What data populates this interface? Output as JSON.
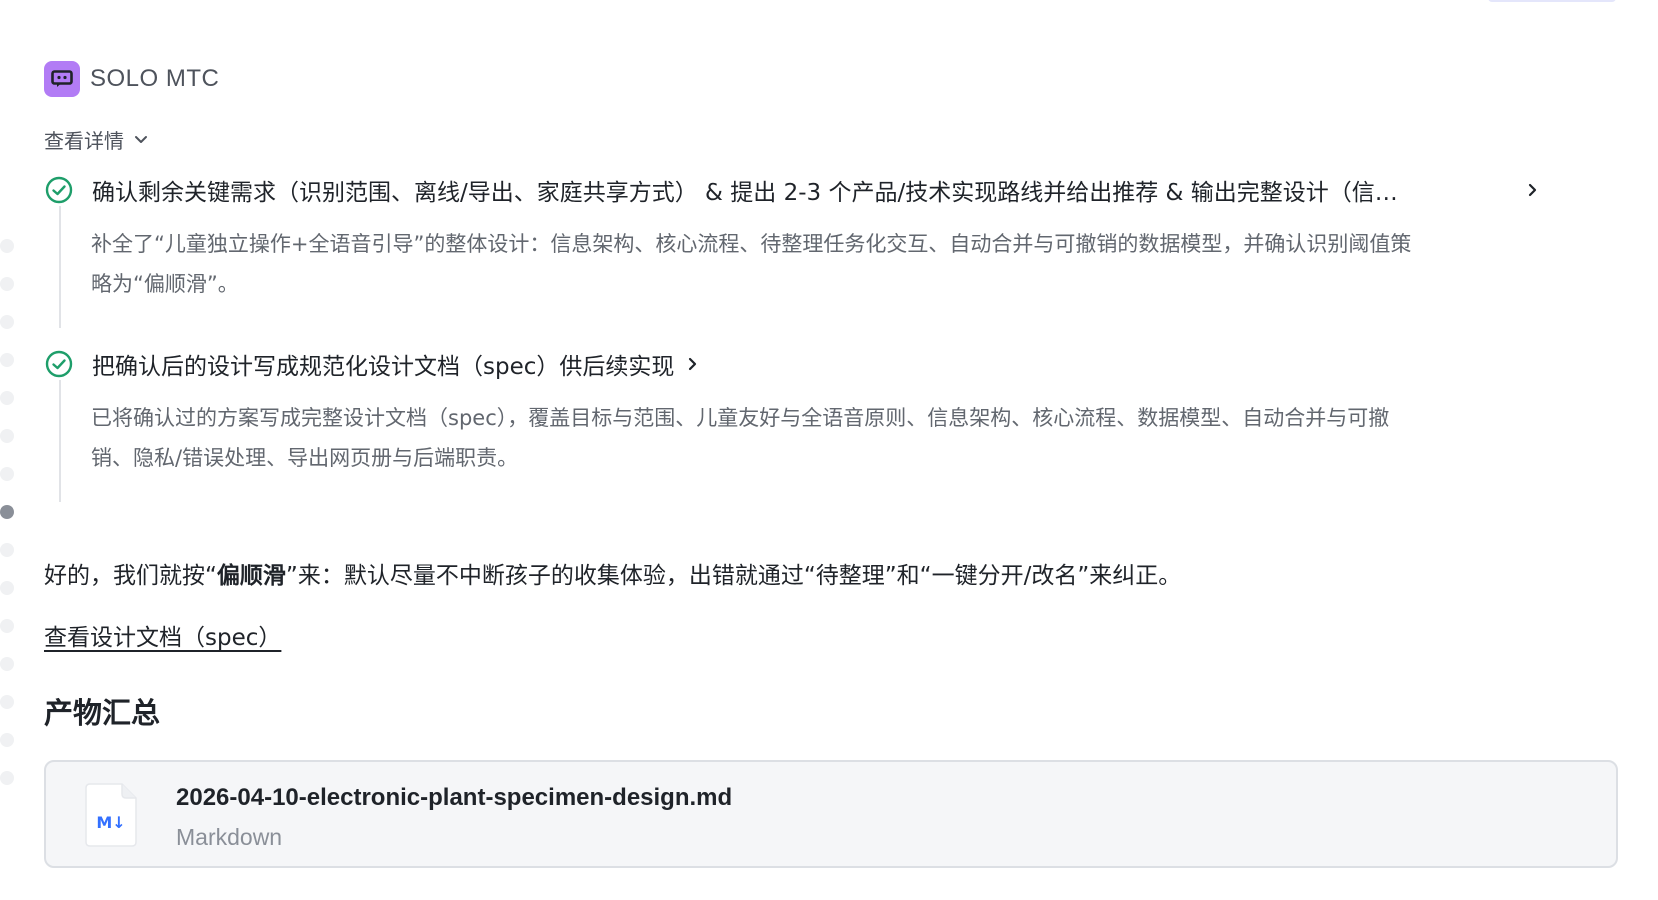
{
  "agent": {
    "name": "SOLO MTC",
    "avatar_color": "#b27cf5"
  },
  "details_toggle": {
    "label": "查看详情"
  },
  "steps": [
    {
      "title": "确认剩余关键需求（识别范围、离线/导出、家庭共享方式） & 提出 2-3 个产品/技术实现路线并给出推荐 & 输出完整设计（信…",
      "summary_line1": "补全了“儿童独立操作+全语音引导”的整体设计：信息架构、核心流程、待整理任务化交互、自动合并与可撤销的数据模型，并确认识别阈值策",
      "summary_line2": "略为“偏顺滑”。",
      "status": "completed"
    },
    {
      "title": "把确认后的设计写成规范化设计文档（spec）供后续实现",
      "summary_line1": "已将确认过的方案写成完整设计文档（spec），覆盖目标与范围、儿童友好与全语音原则、信息架构、核心流程、数据模型、自动合并与可撤",
      "summary_line2": "销、隐私/错误处理、导出网页册与后端职责。",
      "status": "completed"
    }
  ],
  "reply": {
    "prefix": "好的，我们就按“",
    "bold": "偏顺滑",
    "suffix": "”来：默认尽量不中断孩子的收集体验，出错就通过“待整理”和“一键分开/改名”来纠正。"
  },
  "spec_link": {
    "label": "查看设计文档（spec）"
  },
  "artifacts": {
    "title": "产物汇总",
    "files": [
      {
        "name": "2026-04-10-electronic-plant-specimen-design.md",
        "type": "Markdown",
        "icon_label": "M↓"
      }
    ]
  },
  "colors": {
    "check_green": "#1e9e6a",
    "link_blue": "#3370ff"
  }
}
